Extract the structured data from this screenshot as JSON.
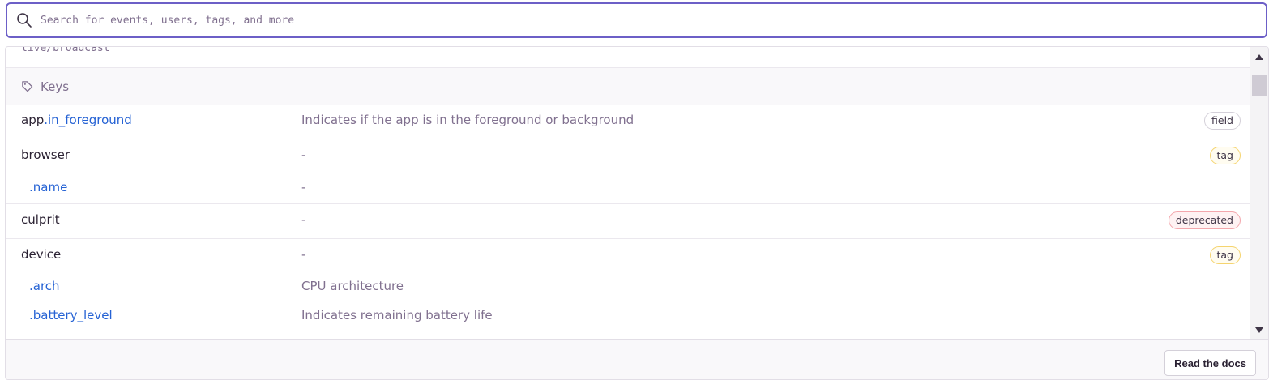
{
  "search": {
    "placeholder": "Search for events, users, tags, and more"
  },
  "clipped_line": "live/broadcast",
  "section": {
    "label": "Keys"
  },
  "rows": [
    {
      "key_prefix": "app",
      "key_child": ".in_foreground",
      "description": "Indicates if the app is in the foreground or background",
      "badge": "field"
    },
    {
      "key": "browser",
      "description": "-",
      "badge": "tag"
    },
    {
      "key": "browser.name",
      "key_child": ".name",
      "description": "-"
    },
    {
      "key": "culprit",
      "description": "-",
      "badge": "deprecated"
    },
    {
      "key": "device",
      "description": "-",
      "badge": "tag"
    },
    {
      "key_child": ".arch",
      "description": "CPU architecture"
    },
    {
      "key_child": ".battery_level",
      "description": "Indicates remaining battery life"
    }
  ],
  "footer": {
    "button_label": "Read the docs"
  }
}
